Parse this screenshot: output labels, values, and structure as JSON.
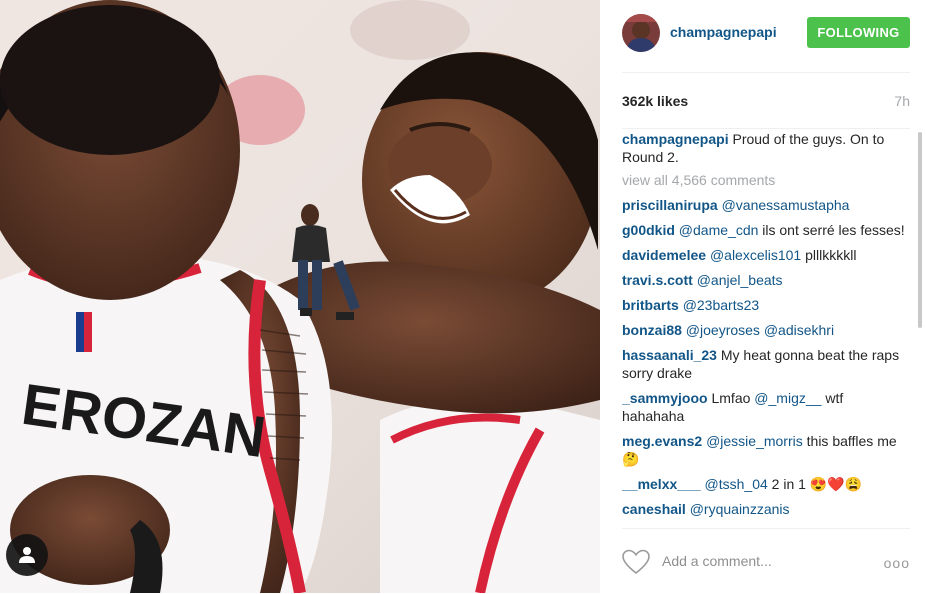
{
  "post": {
    "username": "champagnepapi",
    "follow_label": "FOLLOWING",
    "likes": "362k likes",
    "time": "7h",
    "caption": "Proud of the guys. On to Round 2.",
    "view_all": "view all 4,566 comments"
  },
  "photo": {
    "jersey_text": "ERОZAN"
  },
  "comments": [
    {
      "user": "priscillanirupa",
      "mention": "@vanessamustapha",
      "text": ""
    },
    {
      "user": "g00dkid",
      "mention": "@dame_cdn",
      "text": "ils ont serré les fesses!"
    },
    {
      "user": "davidemelee",
      "mention": "@alexcelis101",
      "text": "plllkkkkll"
    },
    {
      "user": "travi.s.cott",
      "mention": "@anjel_beats",
      "text": ""
    },
    {
      "user": "britbarts",
      "mention": "@23barts23",
      "text": ""
    },
    {
      "user": "bonzai88",
      "mention": "@joeyroses @adisekhri",
      "text": ""
    },
    {
      "user": "hassaanali_23",
      "mention": "",
      "text": "My heat gonna beat the raps sorry drake"
    },
    {
      "user": "_sammyjooo",
      "mention": "",
      "text": "Lmfao",
      "mention2": "@_migz__",
      "text2": "wtf hahahaha"
    },
    {
      "user": "meg.evans2",
      "mention": "@jessie_morris",
      "text": "this baffles me 🤔"
    },
    {
      "user": "__melxx___",
      "mention": "@tssh_04",
      "text": "2 in 1 😍❤️😩"
    },
    {
      "user": "caneshail",
      "mention": "@ryquainzzanis",
      "text": ""
    }
  ],
  "footer": {
    "placeholder": "Add a comment...",
    "more": "ooo"
  },
  "colors": {
    "link": "#125688",
    "follow_bg": "#4cc14c",
    "muted": "#a5a7aa"
  },
  "icons": [
    "person-tag-icon",
    "heart-icon",
    "more-options-icon"
  ]
}
